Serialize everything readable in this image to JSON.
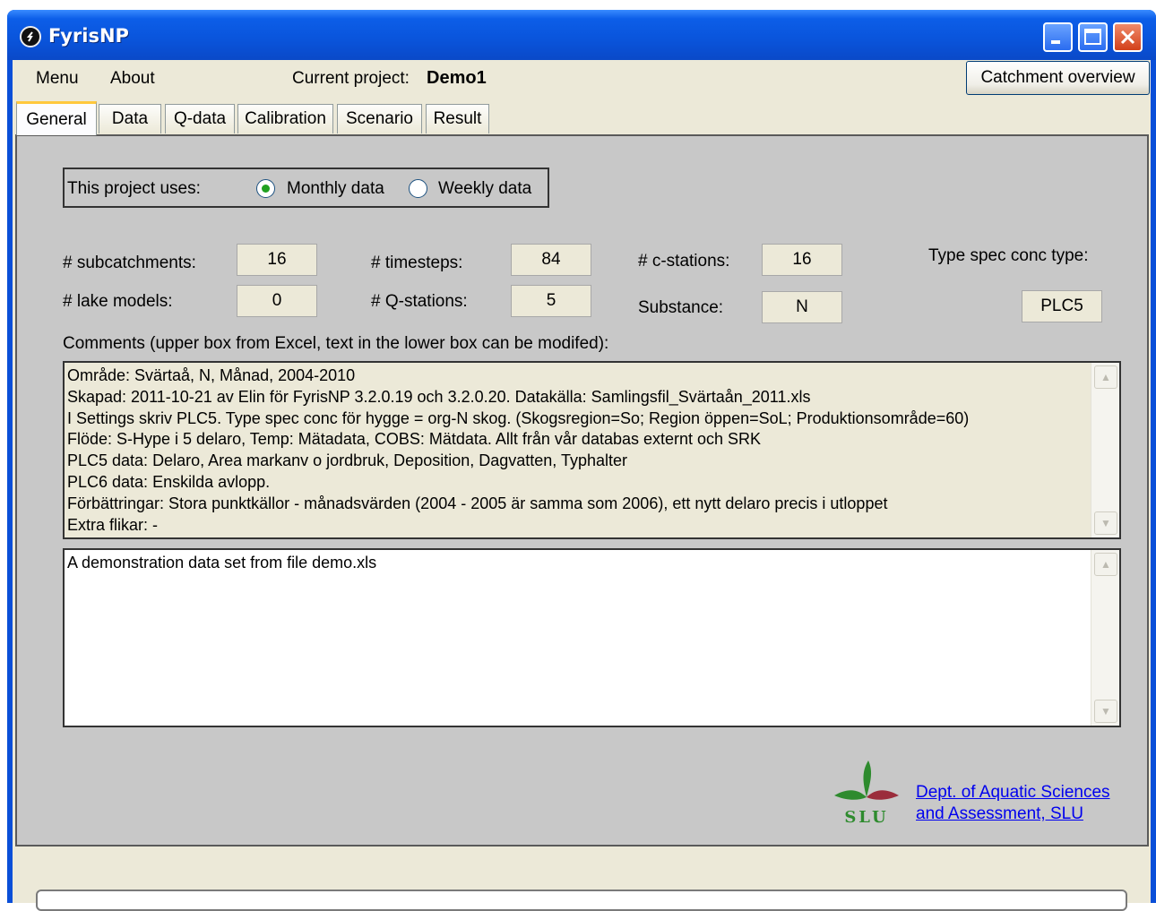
{
  "window": {
    "title": "FyrisNP"
  },
  "menu": {
    "items": [
      "Menu",
      "About"
    ]
  },
  "project": {
    "label": "Current project:",
    "name": "Demo1"
  },
  "toolbar": {
    "catchment_overview": "Catchment overview"
  },
  "tabs": [
    "General",
    "Data",
    "Q-data",
    "Calibration",
    "Scenario",
    "Result"
  ],
  "active_tab": "General",
  "uses": {
    "label": "This project uses:",
    "options": [
      "Monthly data",
      "Weekly data"
    ],
    "selected": "Monthly data"
  },
  "stats": {
    "subcatchments": {
      "label": "# subcatchments:",
      "value": "16"
    },
    "timesteps": {
      "label": "# timesteps:",
      "value": "84"
    },
    "cstations": {
      "label": "# c-stations:",
      "value": "16"
    },
    "type_spec": {
      "label": "Type spec conc type:",
      "value": "PLC5"
    },
    "lake_models": {
      "label": "# lake models:",
      "value": "0"
    },
    "qstations": {
      "label": "# Q-stations:",
      "value": "5"
    },
    "substance": {
      "label": "Substance:",
      "value": "N"
    }
  },
  "comments": {
    "label": "Comments (upper box from Excel, text in the lower box can be modifed):",
    "upper_lines": [
      "Område: Svärtaå, N, Månad, 2004-2010",
      "Skapad: 2011-10-21 av Elin för FyrisNP 3.2.0.19 och 3.2.0.20. Datakälla: Samlingsfil_Svärtaån_2011.xls",
      "I Settings skriv PLC5. Type spec conc för hygge = org-N skog. (Skogsregion=So; Region öppen=SoL; Produktionsområde=60)",
      "Flöde: S-Hype i 5 delaro, Temp: Mätadata, COBS: Mätdata. Allt från vår databas externt och SRK",
      "PLC5 data: Delaro, Area markanv o jordbruk, Deposition, Dagvatten, Typhalter",
      "PLC6 data: Enskilda avlopp.",
      "Förbättringar: Stora punktkällor - månadsvärden (2004 - 2005 är samma som 2006), ett nytt delaro precis i utloppet",
      "Extra flikar: -"
    ],
    "lower_text": "A demonstration data set from file demo.xls"
  },
  "branding": {
    "logo_text": "SLU",
    "dept_line1": "Dept. of Aquatic Sciences",
    "dept_line2": "and Assessment, SLU"
  },
  "colors": {
    "titlebar": "#0a54db",
    "panel": "#c8c8c8",
    "client": "#ece9d8",
    "logo_green": "#2e8b2e",
    "logo_red": "#9b2d3c",
    "radio_selected": "#21a121"
  }
}
